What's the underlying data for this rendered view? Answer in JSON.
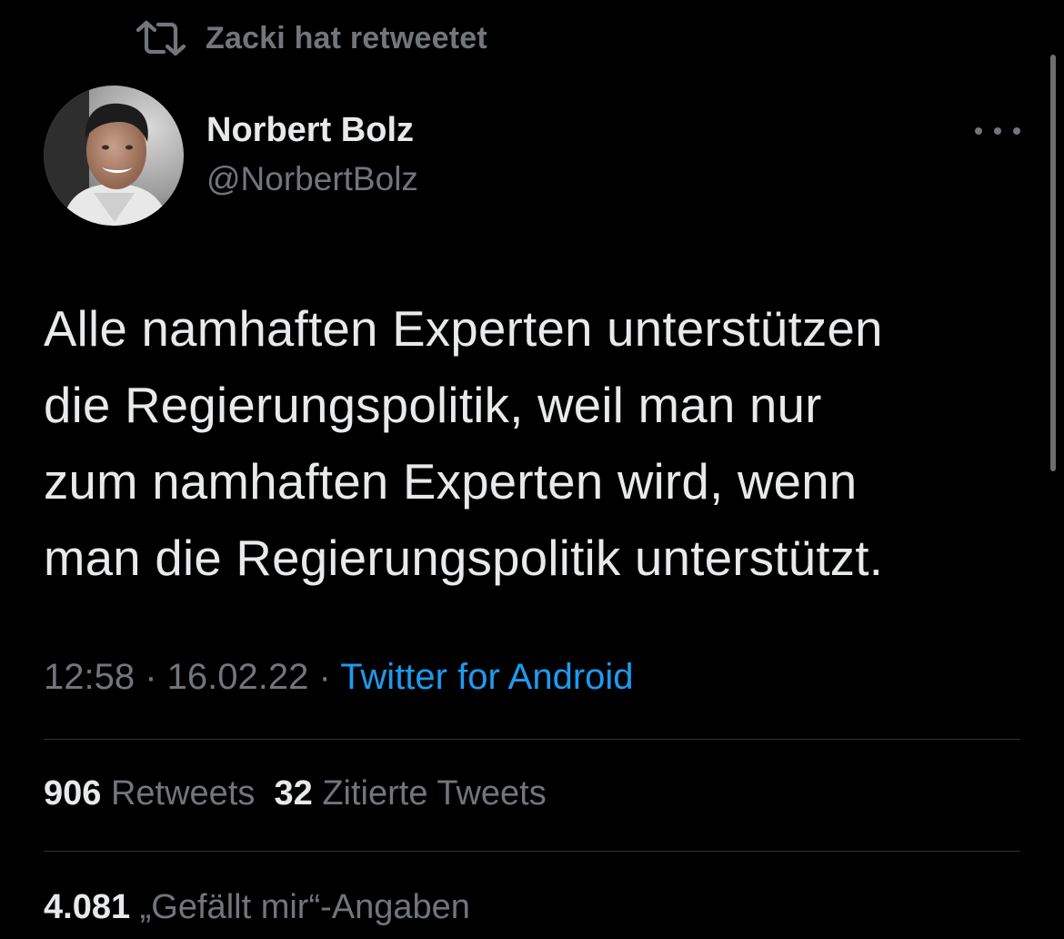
{
  "retweet_context": {
    "icon": "retweet-icon",
    "text": "Zacki hat retweetet"
  },
  "author": {
    "name": "Norbert Bolz",
    "handle": "@NorbertBolz",
    "avatar": "avatar"
  },
  "more_icon": "more-horizontal-icon",
  "tweet": {
    "lines": [
      "Alle namhaften Experten unterstützen",
      "die Regierungspolitik, weil man nur",
      "zum namhaften Experten wird, wenn",
      "man die Regierungspolitik unterstützt."
    ]
  },
  "meta": {
    "time": "12:58",
    "separator": " · ",
    "date": "16.02.22",
    "source": "Twitter for Android"
  },
  "stats": {
    "retweets_count": "906",
    "retweets_label": "Retweets",
    "quotes_count": "32",
    "quotes_label": "Zitierte Tweets",
    "likes_count": "4.081",
    "likes_label": "„Gefällt mir“-Angaben"
  },
  "colors": {
    "background": "#000000",
    "text_primary": "#e7e9ea",
    "text_secondary": "#71767b",
    "link": "#1d9bf0",
    "divider": "#2f3336"
  }
}
